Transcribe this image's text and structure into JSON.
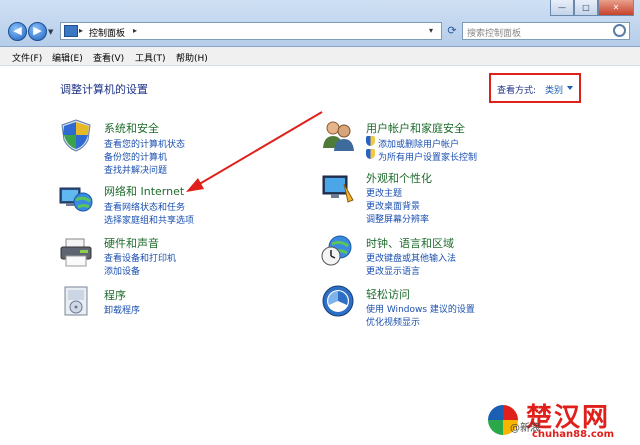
{
  "window": {
    "breadcrumb": "控制面板",
    "search_placeholder": "搜索控制面板",
    "minimize": "—",
    "maximize": "□",
    "close": "✕"
  },
  "menu": [
    "文件(F)",
    "编辑(E)",
    "查看(V)",
    "工具(T)",
    "帮助(H)"
  ],
  "page_title": "调整计算机的设置",
  "view_by": {
    "label": "查看方式:",
    "value": "类别"
  },
  "categories": {
    "system": {
      "title": "系统和安全",
      "links": [
        "查看您的计算机状态",
        "备份您的计算机",
        "查找并解决问题"
      ]
    },
    "network": {
      "title": "网络和 Internet",
      "links": [
        "查看网络状态和任务",
        "选择家庭组和共享选项"
      ]
    },
    "hardware": {
      "title": "硬件和声音",
      "links": [
        "查看设备和打印机",
        "添加设备"
      ]
    },
    "programs": {
      "title": "程序",
      "links": [
        "卸载程序"
      ]
    },
    "users": {
      "title": "用户帐户和家庭安全",
      "links": [
        "添加或删除用户帐户",
        "为所有用户设置家长控制"
      ]
    },
    "appearance": {
      "title": "外观和个性化",
      "links": [
        "更改主题",
        "更改桌面背景",
        "调整屏幕分辨率"
      ]
    },
    "clock": {
      "title": "时钟、语言和区域",
      "links": [
        "更改键盘或其他输入法",
        "更改显示语言"
      ]
    },
    "access": {
      "title": "轻松访问",
      "links": [
        "使用 Windows 建议的设置",
        "优化视频显示"
      ]
    }
  },
  "watermark": {
    "brand": "楚汉网",
    "site": "chuhan88.com",
    "wb": "@新浪"
  },
  "colors": {
    "link": "#1a4fb0",
    "category": "#1e6b2c",
    "highlight": "#e0201b"
  }
}
